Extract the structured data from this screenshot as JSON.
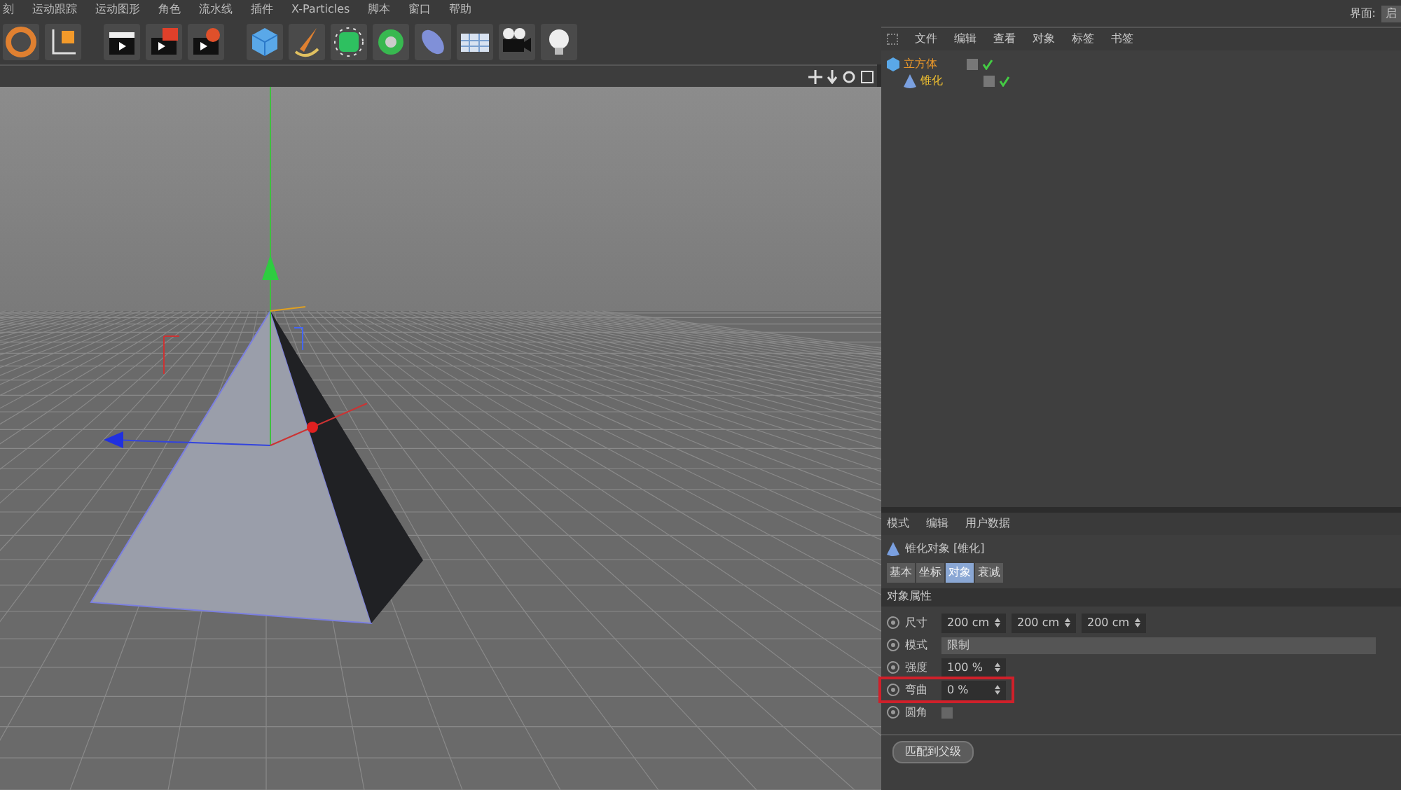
{
  "menu_bar": {
    "items": [
      "刻",
      "运动跟踪",
      "运动图形",
      "角色",
      "流水线",
      "插件",
      "X-Particles",
      "脚本",
      "窗口",
      "帮助"
    ],
    "layout_label": "界面:",
    "layout_value": "启"
  },
  "object_manager": {
    "menu": [
      "文件",
      "编辑",
      "查看",
      "对象",
      "标签",
      "书签"
    ],
    "objects": [
      {
        "name": "立方体",
        "color": "#e8962a",
        "children": [
          {
            "name": "锥化",
            "color": "#f0c030"
          }
        ]
      }
    ]
  },
  "attribute_manager": {
    "menu": [
      "模式",
      "编辑",
      "用户数据"
    ],
    "title": "锥化对象 [锥化]",
    "tabs": [
      {
        "label": "基本",
        "selected": false
      },
      {
        "label": "坐标",
        "selected": false
      },
      {
        "label": "对象",
        "selected": true
      },
      {
        "label": "衰减",
        "selected": false
      }
    ],
    "section": "对象属性",
    "fields": [
      {
        "kind": "vector",
        "label": "尺寸",
        "values": [
          "200 cm",
          "200 cm",
          "200 cm"
        ],
        "highlighted": false
      },
      {
        "kind": "dropdown",
        "label": "模式",
        "value": "限制",
        "highlighted": false
      },
      {
        "kind": "number",
        "label": "强度",
        "value": "100 %",
        "highlighted": false
      },
      {
        "kind": "number",
        "label": "弯曲",
        "value": "0 %",
        "highlighted": true
      },
      {
        "kind": "checkbox",
        "label": "圆角",
        "checked": false,
        "highlighted": false
      }
    ],
    "button": "匹配到父级"
  }
}
